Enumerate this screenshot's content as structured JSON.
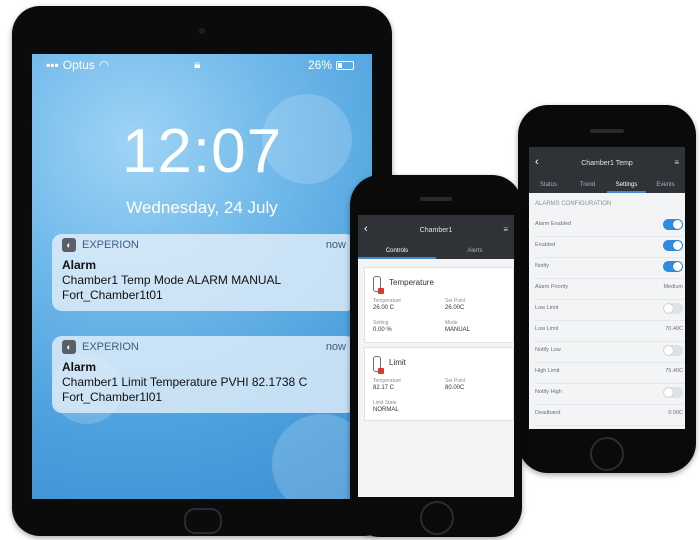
{
  "ipad": {
    "status": {
      "carrier": "Optus",
      "battery": "26%"
    },
    "time": "12:07",
    "date": "Wednesday, 24 July",
    "notifications": [
      {
        "app": "EXPERION",
        "when": "now",
        "title": "Alarm",
        "line1": "Chamber1 Temp Mode ALARM MANUAL",
        "line2": "Fort_Chamber1t01"
      },
      {
        "app": "EXPERION",
        "when": "now",
        "title": "Alarm",
        "line1": "Chamber1  Limit Temperature PVHI 82.1738 C",
        "line2": "Fort_Chamber1l01"
      }
    ]
  },
  "phone1": {
    "title": "Chamber1",
    "tabs": [
      "Controls",
      "Alerts"
    ],
    "cards": [
      {
        "title": "Temperature",
        "fields": [
          {
            "label": "Temperature",
            "value": "26.00 C"
          },
          {
            "label": "Set Point",
            "value": "26.00C"
          },
          {
            "label": "Setting",
            "value": "0.00 %"
          },
          {
            "label": "Mode",
            "value": "MANUAL"
          }
        ]
      },
      {
        "title": "Limit",
        "fields": [
          {
            "label": "Temperature",
            "value": "82.17 C"
          },
          {
            "label": "Set Point",
            "value": "80.00C"
          },
          {
            "label": "Limit State",
            "value": "NORMAL"
          }
        ]
      }
    ]
  },
  "phone2": {
    "title": "Chamber1 Temp",
    "tabs": [
      "Status",
      "Trend",
      "Settings",
      "Events"
    ],
    "section": "ALARMS CONFIGURATION",
    "settings": [
      {
        "label": "Alarm Enabled",
        "type": "toggle",
        "on": true
      },
      {
        "label": "Enabled",
        "type": "toggle",
        "on": true
      },
      {
        "label": "Notify",
        "type": "toggle",
        "on": true
      },
      {
        "label": "Alarm Priority",
        "type": "value",
        "value": "Medium"
      },
      {
        "label": "Low Limit",
        "type": "toggle",
        "on": false
      },
      {
        "label": "Low Limit",
        "type": "value",
        "value": "70.40C"
      },
      {
        "label": "Notify Low",
        "type": "toggle",
        "on": false
      },
      {
        "label": "High Limit",
        "type": "value",
        "value": "75.40C"
      },
      {
        "label": "Notify High",
        "type": "toggle",
        "on": false
      },
      {
        "label": "Deadband",
        "type": "value",
        "value": "0.00C"
      }
    ]
  }
}
